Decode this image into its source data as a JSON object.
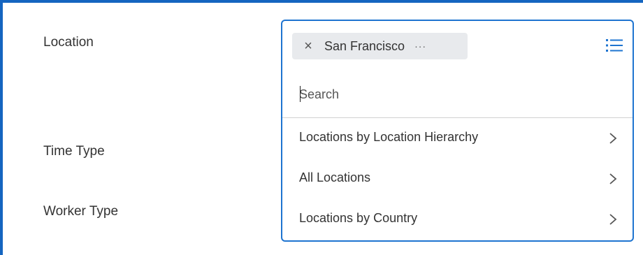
{
  "fields": {
    "location_label": "Location",
    "time_type_label": "Time Type",
    "worker_type_label": "Worker Type"
  },
  "location_prompt": {
    "selected_value": "San Francisco",
    "remove_icon": "close-icon",
    "more_icon": "ellipsis-icon",
    "more_text": "···",
    "list_icon": "list-icon",
    "search_placeholder": "Search",
    "options": [
      {
        "label": "Locations by Location Hierarchy",
        "icon": "chevron-right-icon"
      },
      {
        "label": "All Locations",
        "icon": "chevron-right-icon"
      },
      {
        "label": "Locations by Country",
        "icon": "chevron-right-icon"
      }
    ]
  },
  "colors": {
    "accent": "#1e74d0",
    "frame_border": "#1565c0",
    "pill_background": "#e8eaed",
    "text": "#333333"
  }
}
